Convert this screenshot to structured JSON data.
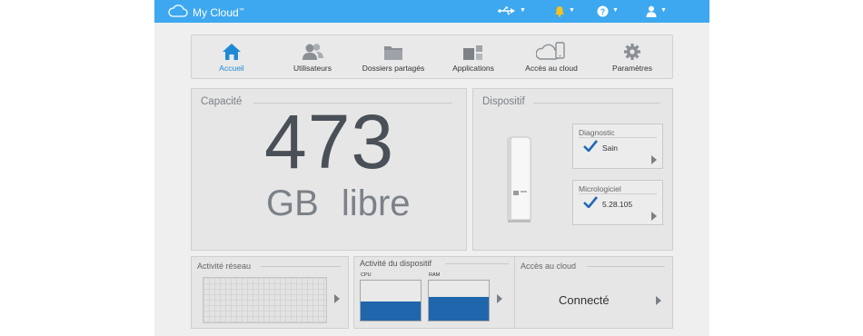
{
  "topbar": {
    "brand": "My Cloud",
    "brand_mark": "™",
    "icons": [
      "usb-icon",
      "bell-icon",
      "help-icon",
      "user-icon"
    ],
    "accent_color": "#3da8ef",
    "bell_color": "#f7c21e"
  },
  "nav": {
    "items": [
      {
        "label": "Accueil",
        "icon": "home-icon",
        "active": true
      },
      {
        "label": "Utilisateurs",
        "icon": "users-icon"
      },
      {
        "label": "Dossiers partagés",
        "icon": "folder-icon"
      },
      {
        "label": "Applications",
        "icon": "apps-icon"
      },
      {
        "label": "Accès au cloud",
        "icon": "cloud-devices-icon"
      },
      {
        "label": "Paramètres",
        "icon": "gear-icon"
      }
    ],
    "active_color": "#1e8ad6"
  },
  "capacity": {
    "title": "Capacité",
    "value": "473",
    "unit": "GB",
    "suffix": "libre"
  },
  "device": {
    "title": "Dispositif",
    "diagnostic": {
      "title": "Diagnostic",
      "value": "Sain"
    },
    "firmware": {
      "title": "Micrologiciel",
      "value": "5.28.105"
    }
  },
  "network": {
    "title": "Activité réseau"
  },
  "device_activity": {
    "title": "Activité du dispositif",
    "cpu_label": "CPU",
    "ram_label": "RAM",
    "cpu_fraction": 0.48,
    "ram_fraction": 0.6,
    "bar_color": "#2066ac"
  },
  "cloud_access": {
    "title": "Accès au cloud",
    "status": "Connecté"
  }
}
